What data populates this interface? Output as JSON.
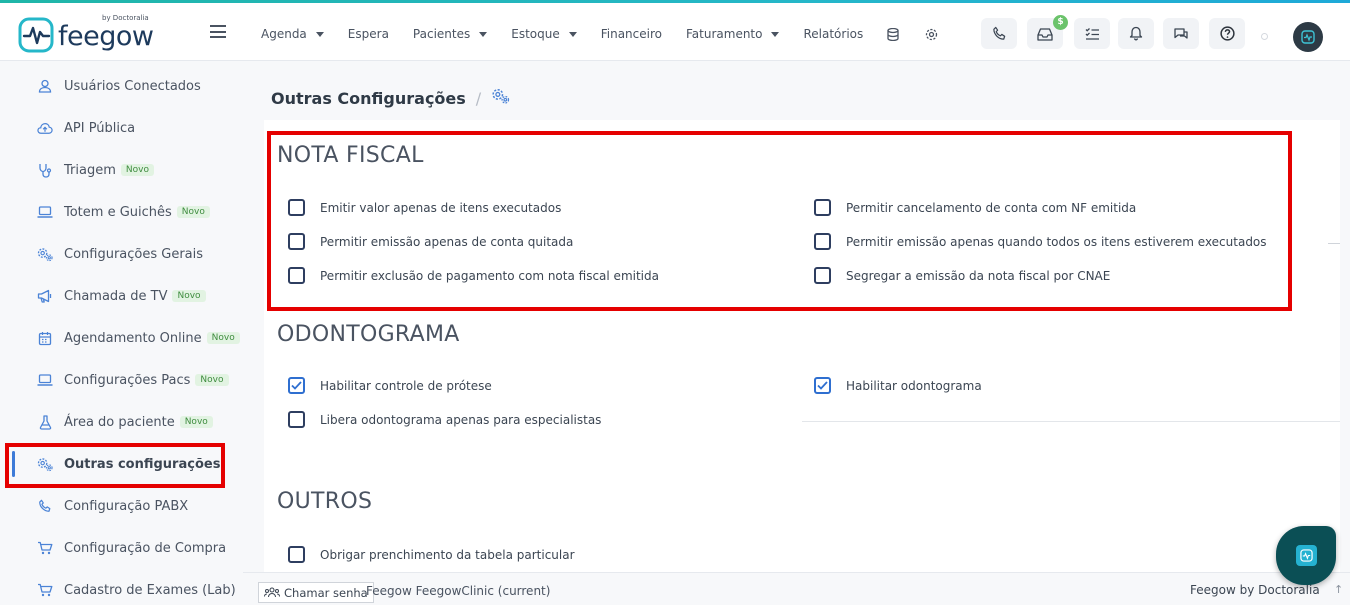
{
  "brand": {
    "name": "feegow",
    "by": "by Doctoralia"
  },
  "topbar": {
    "menu": [
      {
        "label": "Agenda",
        "dropdown": true
      },
      {
        "label": "Espera",
        "dropdown": false
      },
      {
        "label": "Pacientes",
        "dropdown": true
      },
      {
        "label": "Estoque",
        "dropdown": true
      },
      {
        "label": "Financeiro",
        "dropdown": false
      },
      {
        "label": "Faturamento",
        "dropdown": true
      },
      {
        "label": "Relatórios",
        "dropdown": false
      }
    ],
    "icons": [
      "database-icon",
      "gear-icon"
    ],
    "buttons": [
      "phone-icon",
      "inbox-icon",
      "checklist-icon",
      "bell-icon",
      "chat-icon",
      "help-icon"
    ],
    "money_badge": "$"
  },
  "sidebar": {
    "items": [
      {
        "label": "Usuários Conectados",
        "icon": "user-icon",
        "novo": ""
      },
      {
        "label": "API Pública",
        "icon": "cloud-upload-icon",
        "novo": ""
      },
      {
        "label": "Triagem",
        "icon": "stethoscope-icon",
        "novo": "Novo"
      },
      {
        "label": "Totem e Guichês",
        "icon": "laptop-icon",
        "novo": "Novo"
      },
      {
        "label": "Configurações Gerais",
        "icon": "gears-icon",
        "novo": ""
      },
      {
        "label": "Chamada de TV",
        "icon": "megaphone-icon",
        "novo": "Novo"
      },
      {
        "label": "Agendamento Online",
        "icon": "calendar-icon",
        "novo": "Novo"
      },
      {
        "label": "Configurações Pacs",
        "icon": "laptop-icon",
        "novo": "Novo"
      },
      {
        "label": "Área do paciente",
        "icon": "flask-icon",
        "novo": "Novo"
      },
      {
        "label": "Outras configurações",
        "icon": "gears-icon",
        "novo": ""
      },
      {
        "label": "Configuração PABX",
        "icon": "phone-icon",
        "novo": ""
      },
      {
        "label": "Configuração de Compra",
        "icon": "cart-icon",
        "novo": ""
      },
      {
        "label": "Cadastro de Exames (Lab)",
        "icon": "cart-icon",
        "novo": ""
      }
    ],
    "active_index": 9
  },
  "breadcrumb": {
    "title": "Outras Configurações",
    "separator": "/"
  },
  "sections": {
    "nota_fiscal": {
      "title": "NOTA FISCAL",
      "options": [
        {
          "label": "Emitir valor apenas de itens executados",
          "checked": false
        },
        {
          "label": "Permitir emissão apenas de conta quitada",
          "checked": false
        },
        {
          "label": "Permitir exclusão de pagamento com nota fiscal emitida",
          "checked": false
        },
        {
          "label": "Permitir cancelamento de conta com NF emitida",
          "checked": false
        },
        {
          "label": "Permitir emissão apenas quando todos os itens estiverem executados",
          "checked": false
        },
        {
          "label": "Segregar a emissão da nota fiscal por CNAE",
          "checked": false
        }
      ]
    },
    "odontograma": {
      "title": "ODONTOGRAMA",
      "options": [
        {
          "label": "Habilitar controle de prótese",
          "checked": true
        },
        {
          "label": "Libera odontograma apenas para especialistas",
          "checked": false
        },
        {
          "label": "Habilitar odontograma",
          "checked": true
        }
      ]
    },
    "outros": {
      "title": "OUTROS",
      "options": [
        {
          "label": "Obrigar prenchimento da tabela particular",
          "checked": false
        }
      ]
    }
  },
  "footer": {
    "chamar_senha": "Chamar senha",
    "version": "Feegow FeegowClinic (current)",
    "right": "Feegow by Doctoralia",
    "scroll_top": "↑"
  }
}
